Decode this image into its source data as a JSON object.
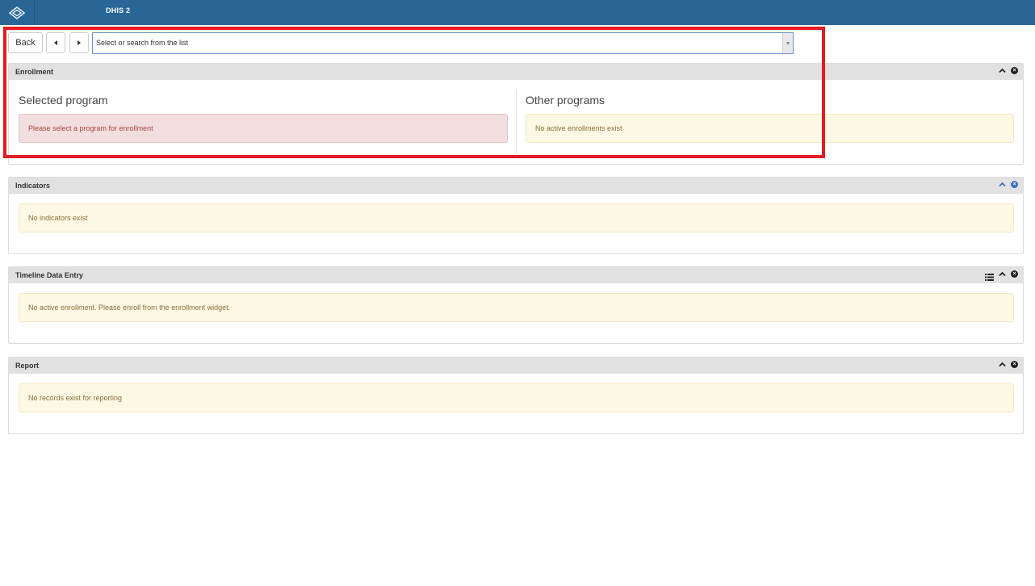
{
  "header": {
    "app_title": "DHIS 2",
    "logo_icon": "dhis2-logo-icon"
  },
  "toolbar": {
    "back_label": "Back",
    "prev_icon": "caret-left-icon",
    "next_icon": "caret-right-icon"
  },
  "program_select": {
    "placeholder": "Select or search from the list"
  },
  "enrollment": {
    "title": "Enrollment",
    "selected_program_title": "Selected program",
    "selected_program_message": "Please select a program for enrollment",
    "other_programs_title": "Other programs",
    "other_programs_message": "No active enrollments exist"
  },
  "indicators": {
    "title": "Indicators",
    "message": "No indicators exist"
  },
  "timeline": {
    "title": "Timeline Data Entry",
    "message": "No active enrollment. Please enroll from the enrollment widget."
  },
  "report": {
    "title": "Report",
    "message": "No records exist for reporting"
  },
  "colors": {
    "header_bg": "#276696",
    "highlight": "#e31b23",
    "warning_bg": "#fcf8e3",
    "danger_bg": "#f2dede"
  }
}
